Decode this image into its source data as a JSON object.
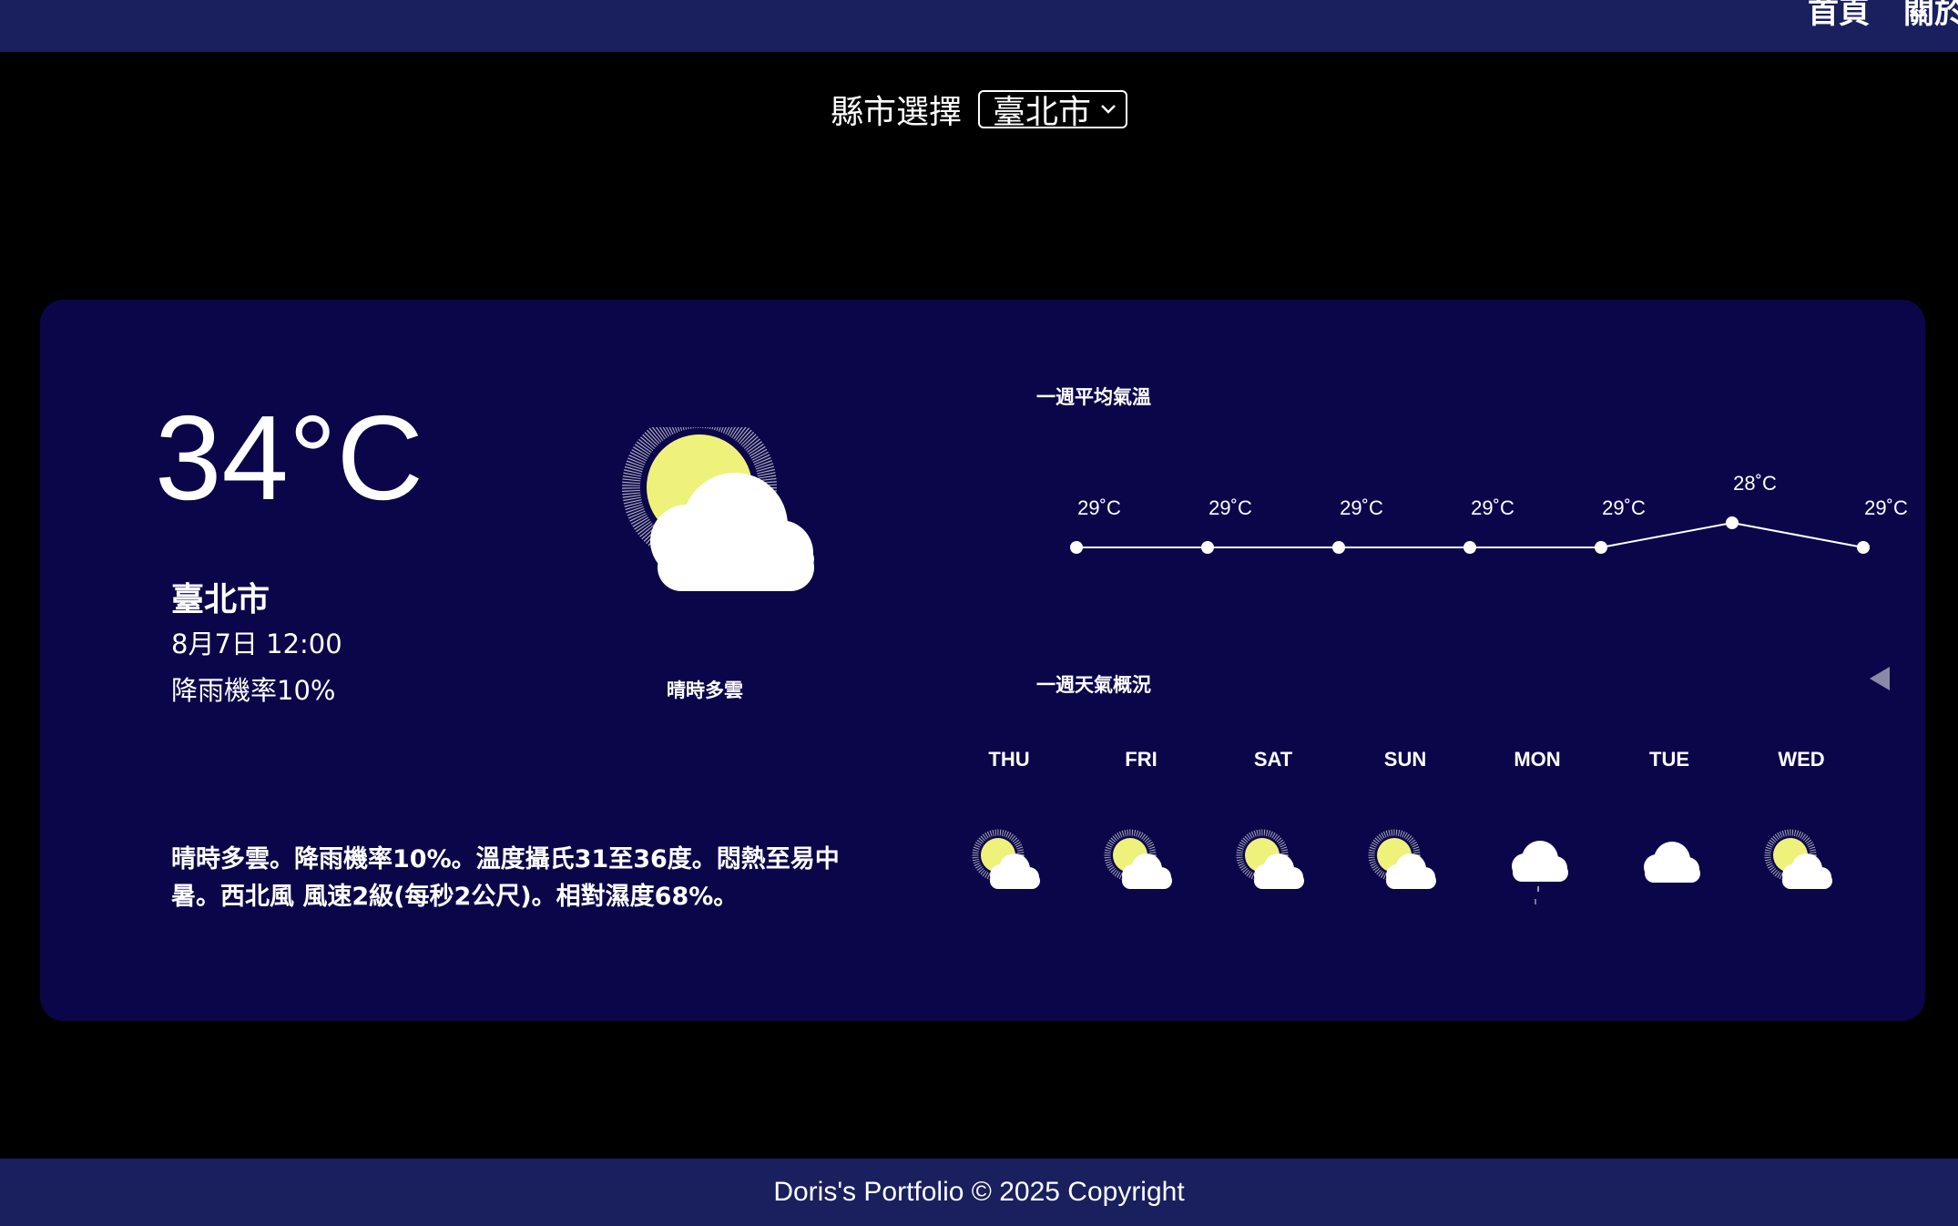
{
  "nav": {
    "home": "首頁",
    "about": "關於"
  },
  "city_select": {
    "label": "縣市選擇",
    "selected": "臺北市"
  },
  "current": {
    "temp": "34°C",
    "city": "臺北市",
    "datetime": "8月7日 12:00",
    "rain": "降雨機率10%",
    "condition": "晴時多雲",
    "icon": "sun-cloud-icon",
    "description": "晴時多雲。降雨機率10%。溫度攝氏31至36度。悶熱至易中暑。西北風 風速2級(每秒2公尺)。相對濕度68%。"
  },
  "weekly_temp": {
    "title": "一週平均氣溫",
    "chart_data": {
      "type": "line",
      "categories": [
        "THU",
        "FRI",
        "SAT",
        "SUN",
        "MON",
        "TUE",
        "WED"
      ],
      "series": [
        {
          "values": [
            29,
            29,
            29,
            29,
            29,
            28,
            29
          ]
        }
      ],
      "labels": [
        "29˚C",
        "29˚C",
        "29˚C",
        "29˚C",
        "29˚C",
        "28˚C",
        "29˚C"
      ],
      "unit": "˚C"
    }
  },
  "weekly_overview": {
    "title": "一週天氣概況",
    "days": [
      {
        "day": "THU",
        "icon": "sun-cloud-icon"
      },
      {
        "day": "FRI",
        "icon": "sun-cloud-icon"
      },
      {
        "day": "SAT",
        "icon": "sun-cloud-icon"
      },
      {
        "day": "SUN",
        "icon": "sun-cloud-icon"
      },
      {
        "day": "MON",
        "icon": "cloud-rain-icon"
      },
      {
        "day": "TUE",
        "icon": "cloud-icon"
      },
      {
        "day": "WED",
        "icon": "sun-cloud-icon"
      }
    ]
  },
  "colors": {
    "card": "#0b064a",
    "header": "#1a1f5e",
    "sun": "#eef27a",
    "cloud": "#ffffff"
  },
  "footer": {
    "text": "Doris's Portfolio © 2025 Copyright"
  }
}
